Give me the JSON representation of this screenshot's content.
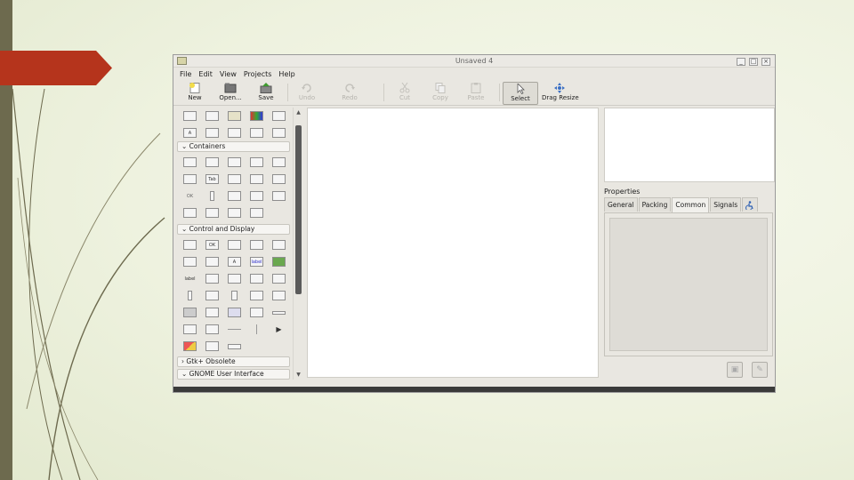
{
  "window": {
    "title": "Unsaved 4",
    "controls": [
      "_",
      "□",
      "×"
    ]
  },
  "menu": [
    "File",
    "Edit",
    "View",
    "Projects",
    "Help"
  ],
  "toolbar": {
    "buttons": [
      {
        "label": "New",
        "icon": "new-document-icon",
        "enabled": true
      },
      {
        "label": "Open...",
        "icon": "folder-open-icon",
        "enabled": true
      },
      {
        "label": "Save",
        "icon": "save-icon",
        "enabled": true
      },
      {
        "label": "Undo",
        "icon": "undo-icon",
        "enabled": false
      },
      {
        "label": "Redo",
        "icon": "redo-icon",
        "enabled": false
      },
      {
        "label": "Cut",
        "icon": "cut-icon",
        "enabled": false
      },
      {
        "label": "Copy",
        "icon": "copy-icon",
        "enabled": false
      },
      {
        "label": "Paste",
        "icon": "paste-icon",
        "enabled": false
      },
      {
        "label": "Select",
        "icon": "pointer-icon",
        "enabled": true,
        "active": true
      },
      {
        "label": "Drag Resize",
        "icon": "drag-resize-icon",
        "enabled": true
      }
    ]
  },
  "palette": {
    "groups": [
      {
        "label": "Containers",
        "expanded": true
      },
      {
        "label": "Control and Display",
        "expanded": true
      },
      {
        "label": "Gtk+ Obsolete",
        "expanded": false
      },
      {
        "label": "GNOME User Interface",
        "expanded": false
      }
    ],
    "widget_text": {
      "ok": "OK",
      "abc": "abc",
      "label": "label",
      "tab": "Tab",
      "a": "A"
    }
  },
  "properties": {
    "title": "Properties",
    "tabs": [
      "General",
      "Packing",
      "Common",
      "Signals"
    ],
    "active_tab": "Common",
    "accessibility_icon": "accessibility-icon"
  },
  "colors": {
    "slide_bar": "#6d6a4e",
    "slide_accent": "#b5341c",
    "save_icon": "#3f9b2f",
    "new_icon": "#f2dc4a",
    "drag_icon": "#3a6fc4"
  }
}
